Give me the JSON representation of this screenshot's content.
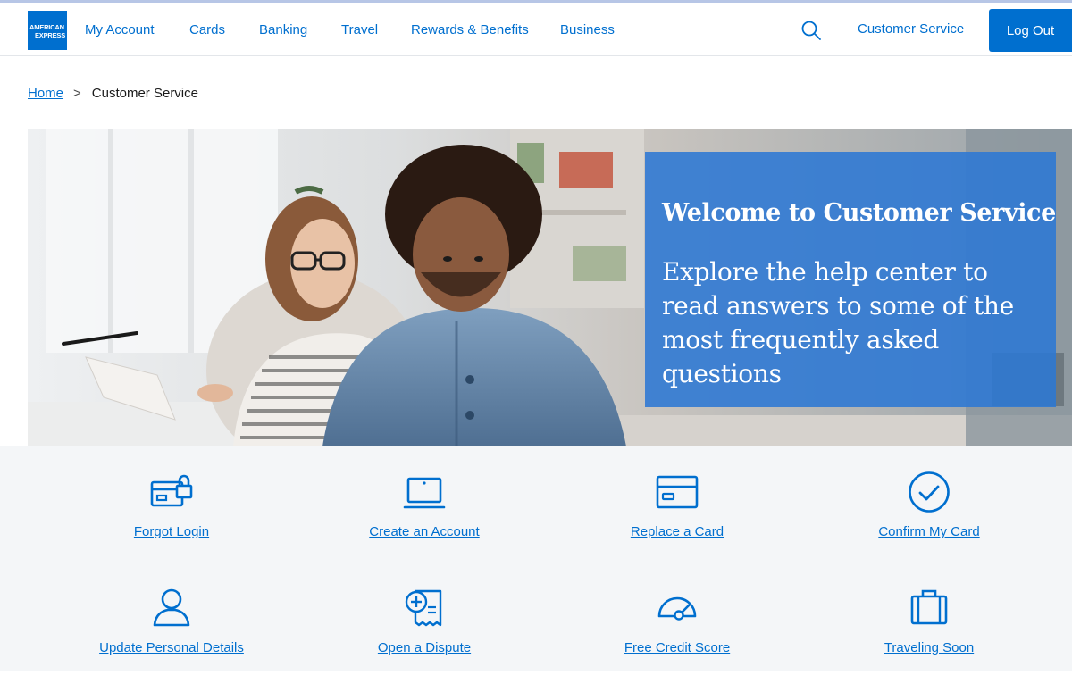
{
  "brand": {
    "logo_line1": "AMERICAN",
    "logo_line2": "EXPRESS",
    "accent": "#006fcf"
  },
  "nav": {
    "items": [
      {
        "label": "My Account"
      },
      {
        "label": "Cards"
      },
      {
        "label": "Banking"
      },
      {
        "label": "Travel"
      },
      {
        "label": "Rewards & Benefits"
      },
      {
        "label": "Business"
      }
    ],
    "search_icon": "search-icon",
    "customer_service": "Customer Service",
    "logout": "Log Out"
  },
  "breadcrumb": {
    "home": "Home",
    "separator": ">",
    "current": "Customer Service"
  },
  "hero": {
    "title": "Welcome to Customer Service",
    "text": "Explore the help center to read answers to some of the most frequently asked questions",
    "panel_color": "#2c77d4"
  },
  "tiles": [
    {
      "label": "Forgot Login",
      "icon": "card-lock-icon"
    },
    {
      "label": "Create an Account",
      "icon": "laptop-icon"
    },
    {
      "label": "Replace a Card",
      "icon": "credit-card-icon"
    },
    {
      "label": "Confirm My Card",
      "icon": "check-circle-icon"
    },
    {
      "label": "Update Personal Details",
      "icon": "user-icon"
    },
    {
      "label": "Open a Dispute",
      "icon": "receipt-plus-icon"
    },
    {
      "label": "Free Credit Score",
      "icon": "gauge-icon"
    },
    {
      "label": "Traveling Soon",
      "icon": "suitcase-icon"
    }
  ]
}
